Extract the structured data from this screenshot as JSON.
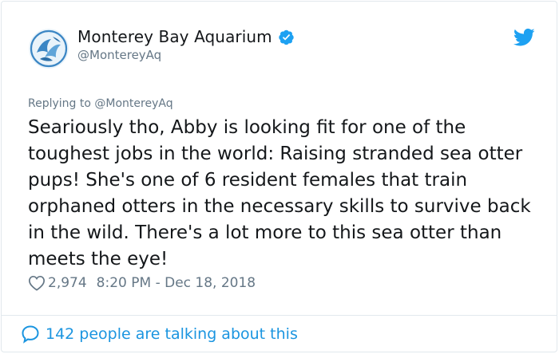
{
  "account": {
    "name": "Monterey Bay Aquarium",
    "handle": "@MontereyAq"
  },
  "reply": {
    "prefix": "Replying to",
    "to_handle": "@MontereyAq"
  },
  "tweet": {
    "text": "Seariously tho, Abby is looking fit for one of the toughest jobs in the world: Raising stranded sea otter pups! She's one of 6 resident females that train orphaned otters in the necessary skills to survive back in the wild. There's a lot more to this sea otter than meets the eye!",
    "likes": "2,974",
    "timestamp": "8:20 PM - Dec 18, 2018"
  },
  "footer": {
    "talking_label": "142 people are talking about this"
  },
  "icons": {
    "avatar": "monterey-bay-aquarium-logo",
    "verified": "verified-badge-icon",
    "brand": "twitter-bird-icon",
    "like": "heart-outline-icon",
    "comment": "speech-bubble-icon"
  },
  "colors": {
    "accent": "#1b95e0",
    "verified": "#1da1f2",
    "muted": "#657786",
    "text": "#14171a",
    "border": "#e1e8ed"
  }
}
